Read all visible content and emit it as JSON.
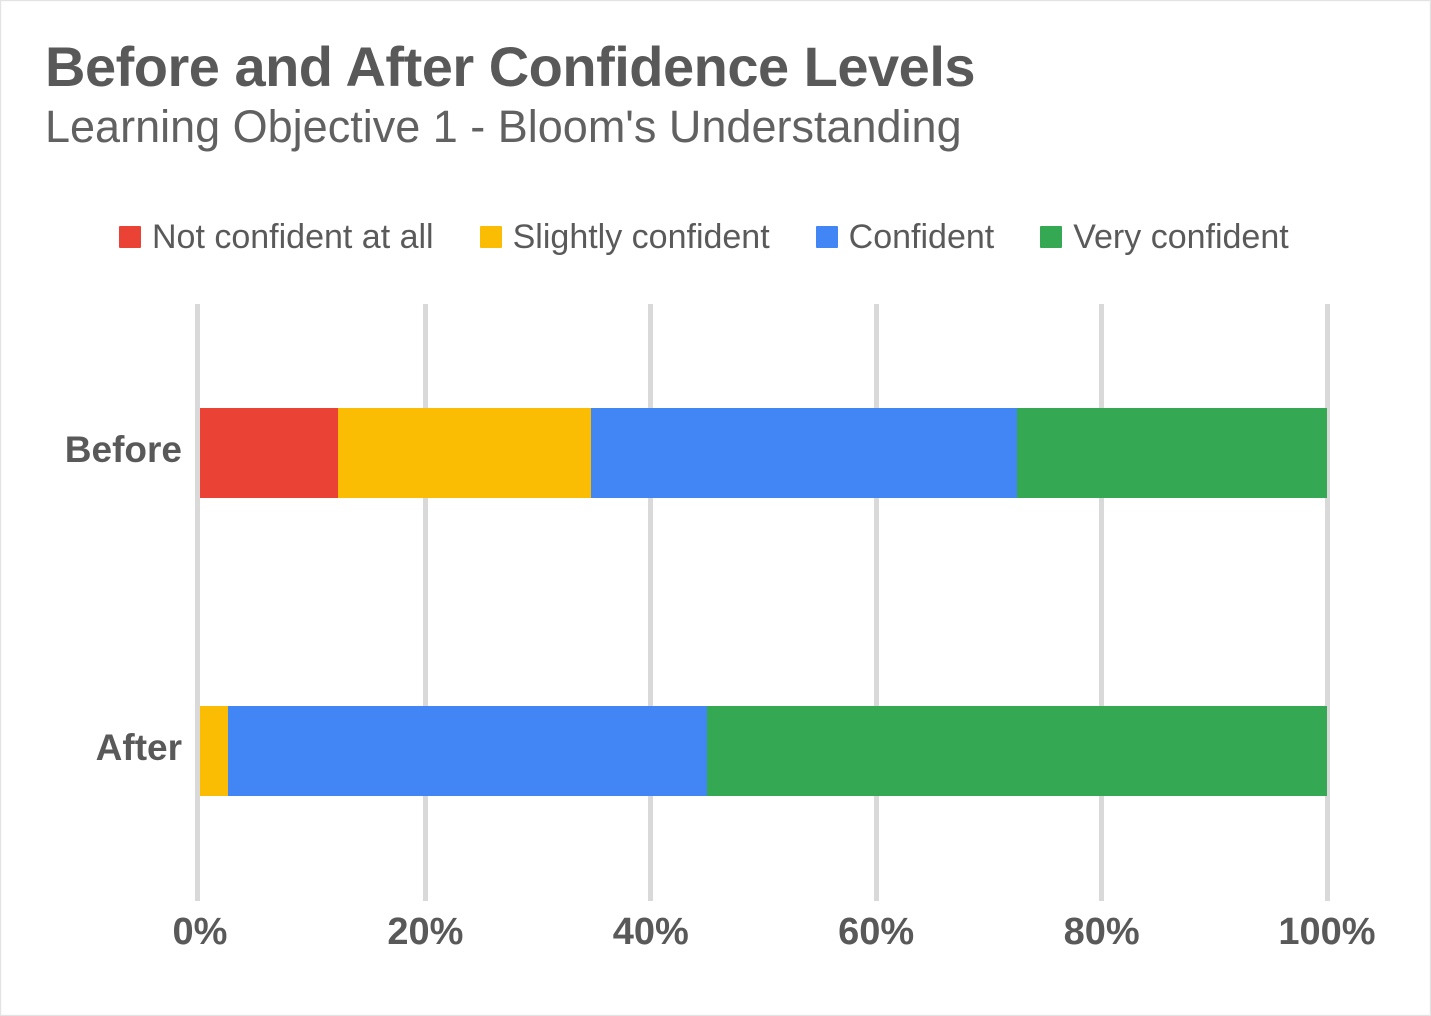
{
  "header": {
    "title": "Before and After Confidence Levels",
    "subtitle": "Learning Objective 1 - Bloom's Understanding"
  },
  "legend": {
    "position": "top",
    "items": [
      {
        "label": "Not confident at all",
        "color": "#EA4335",
        "swatch_icon": "square-swatch-icon"
      },
      {
        "label": "Slightly confident",
        "color": "#FBBC04",
        "swatch_icon": "square-swatch-icon"
      },
      {
        "label": "Confident",
        "color": "#4285F4",
        "swatch_icon": "square-swatch-icon"
      },
      {
        "label": "Very confident",
        "color": "#34A853",
        "swatch_icon": "square-swatch-icon"
      }
    ]
  },
  "axis": {
    "ticks": [
      "0%",
      "20%",
      "40%",
      "60%",
      "80%",
      "100%"
    ],
    "categories": [
      "Before",
      "After"
    ]
  },
  "colors": {
    "not_confident": "#EA4335",
    "slightly_confident": "#FBBC04",
    "confident": "#4285F4",
    "very_confident": "#34A853",
    "text": "#595959",
    "gridline": "#D9D9D9",
    "background": "#FFFFFF"
  },
  "chart_data": {
    "type": "bar",
    "orientation": "horizontal",
    "stacked": true,
    "stack_mode": "percent",
    "title": "Before and After Confidence Levels",
    "subtitle": "Learning Objective 1 - Bloom's Understanding",
    "xlabel": "",
    "ylabel": "",
    "xlim": [
      0,
      100
    ],
    "xticks": [
      0,
      20,
      40,
      60,
      80,
      100
    ],
    "xtick_labels": [
      "0%",
      "20%",
      "40%",
      "60%",
      "80%",
      "100%"
    ],
    "grid": true,
    "grid_axis": "x",
    "legend_position": "top",
    "categories": [
      "Before",
      "After"
    ],
    "series": [
      {
        "name": "Not confident at all",
        "color": "#EA4335",
        "values": [
          12.25,
          0
        ]
      },
      {
        "name": "Slightly confident",
        "color": "#FBBC04",
        "values": [
          22.45,
          2.5
        ]
      },
      {
        "name": "Confident",
        "color": "#4285F4",
        "values": [
          37.8,
          42.5
        ]
      },
      {
        "name": "Very confident",
        "color": "#34A853",
        "values": [
          27.5,
          55.0
        ]
      }
    ]
  }
}
